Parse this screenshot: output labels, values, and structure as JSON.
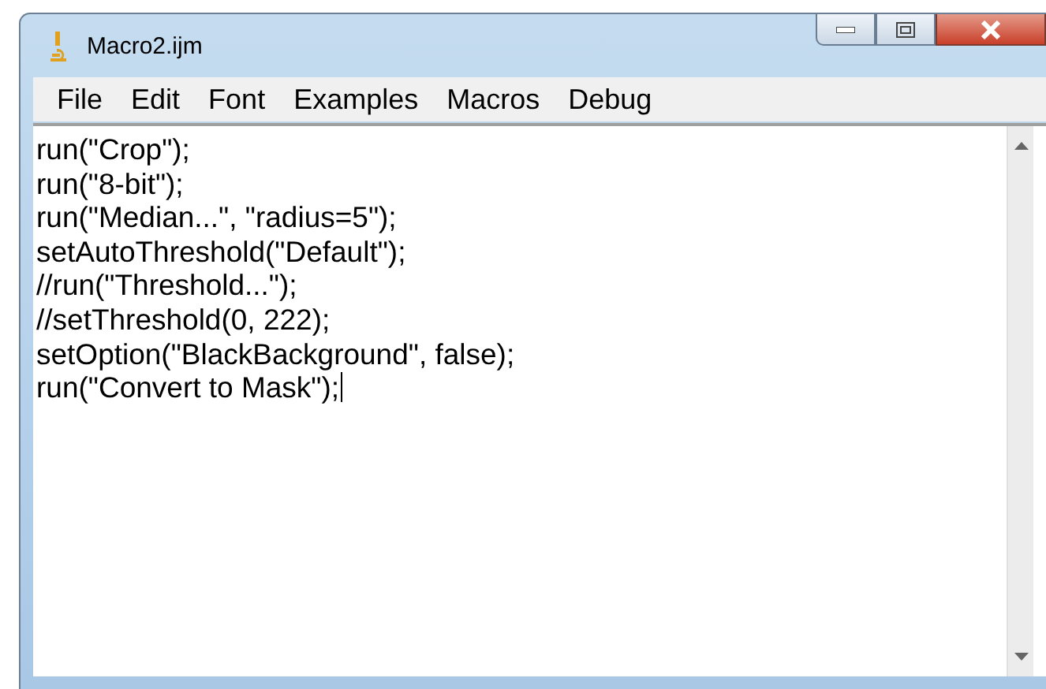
{
  "window": {
    "title": "Macro2.ijm"
  },
  "menu": [
    "File",
    "Edit",
    "Font",
    "Examples",
    "Macros",
    "Debug"
  ],
  "editor": {
    "lines": [
      "run(\"Crop\");",
      "run(\"8-bit\");",
      "run(\"Median...\", \"radius=5\");",
      "setAutoThreshold(\"Default\");",
      "//run(\"Threshold...\");",
      "//setThreshold(0, 222);",
      "setOption(\"BlackBackground\", false);",
      "run(\"Convert to Mask\");"
    ]
  }
}
